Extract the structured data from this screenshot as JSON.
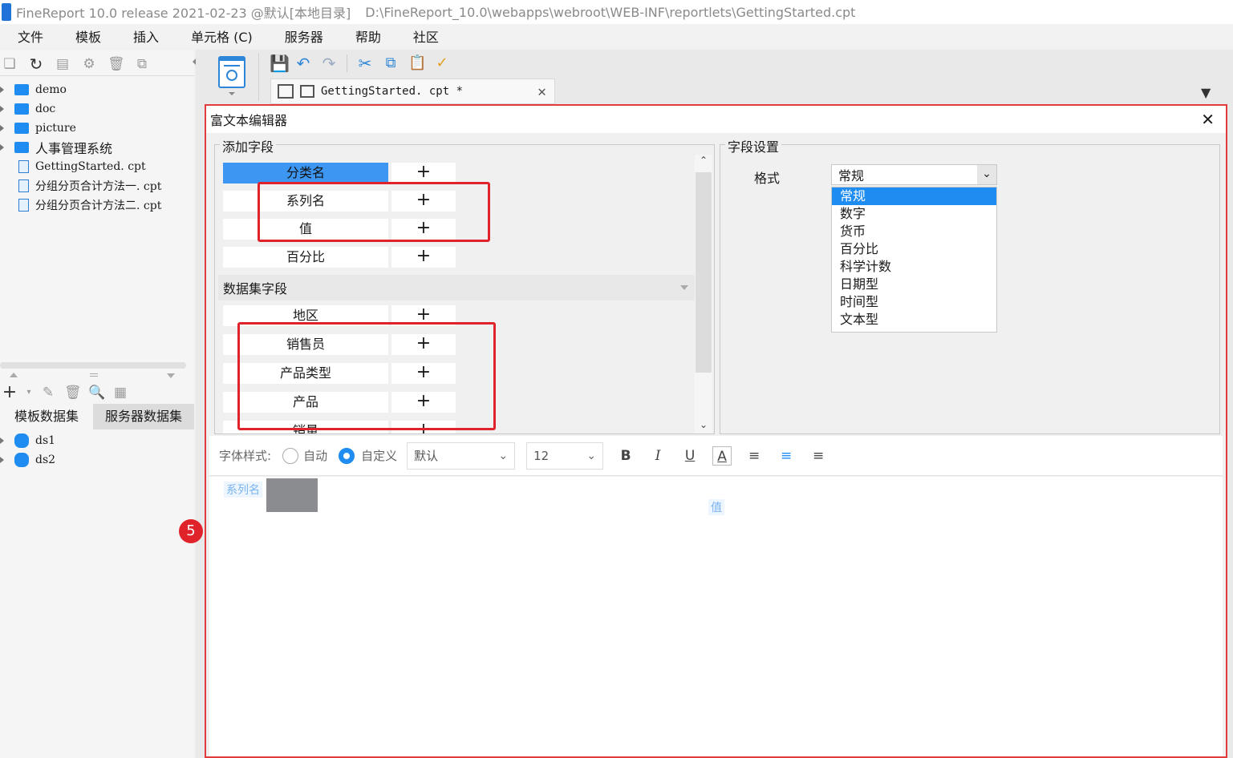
{
  "window": {
    "title": "FineReport 10.0 release 2021-02-23 @默认[本地目录]",
    "path": "D:\\FineReport_10.0\\webapps\\webroot\\WEB-INF\\reportlets\\GettingStarted.cpt"
  },
  "menu": [
    "文件",
    "模板",
    "插入",
    "单元格 (C)",
    "服务器",
    "帮助",
    "社区"
  ],
  "tree": [
    {
      "label": "demo",
      "type": "folder"
    },
    {
      "label": "doc",
      "type": "folder"
    },
    {
      "label": "picture",
      "type": "folder"
    },
    {
      "label": "人事管理系统",
      "type": "folder"
    },
    {
      "label": "GettingStarted. cpt",
      "type": "file"
    },
    {
      "label": "分组分页合计方法一. cpt",
      "type": "file"
    },
    {
      "label": "分组分页合计方法二. cpt",
      "type": "file"
    }
  ],
  "dataset_tabs": [
    "模板数据集",
    "服务器数据集"
  ],
  "datasets": [
    "ds1",
    "ds2"
  ],
  "editor_tab": "GettingStarted. cpt *",
  "dialog": {
    "title": "富文本编辑器",
    "add_field_title": "添加字段",
    "fields": [
      "分类名",
      "系列名",
      "值",
      "百分比"
    ],
    "dataset_section": "数据集字段",
    "dataset_fields": [
      "地区",
      "销售员",
      "产品类型",
      "产品",
      "销量"
    ],
    "field_settings_title": "字段设置",
    "format_label": "格式",
    "format_value": "常规",
    "format_options": [
      "常规",
      "数字",
      "货币",
      "百分比",
      "科学计数",
      "日期型",
      "时间型",
      "文本型"
    ],
    "font_style_label": "字体样式:",
    "auto_label": "自动",
    "custom_label": "自定义",
    "font_family": "默认",
    "font_size": "12",
    "tag_series": "系列名",
    "tag_value": "值"
  },
  "step_badge": "5",
  "colors": {
    "accent": "#1e8cf0",
    "highlight": "#e0222a"
  }
}
